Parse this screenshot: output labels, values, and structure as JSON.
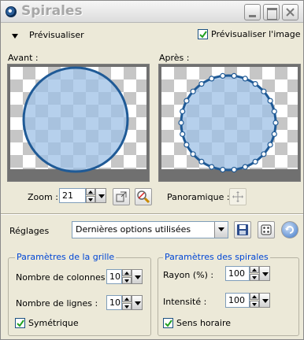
{
  "window": {
    "title": "Spirales"
  },
  "preview": {
    "section_label": "Prévisualiser",
    "preview_image_label": "Prévisualiser l'image",
    "preview_image_checked": true,
    "before_label": "Avant :",
    "after_label": "Après :",
    "zoom_label": "Zoom :",
    "zoom_value": "21",
    "pan_label": "Panoramique :"
  },
  "presets": {
    "label": "Réglages",
    "selected": "Dernières options utilisées"
  },
  "grid_params": {
    "title": "Paramètres de la grille",
    "columns_label": "Nombre de colonnes :",
    "columns_value": "10",
    "rows_label": "Nombre de lignes :",
    "rows_value": "10",
    "symmetric_label": "Symétrique",
    "symmetric_checked": true
  },
  "spiral_params": {
    "title": "Paramètres des spirales",
    "radius_label": "Rayon (%) :",
    "radius_value": "100",
    "intensity_label": "Intensité :",
    "intensity_value": "100",
    "clockwise_label": "Sens horaire",
    "clockwise_checked": true
  },
  "colors": {
    "group_title": "#0046d5",
    "circle_fill": "#9ec0e6",
    "circle_stroke": "#1f5a96"
  }
}
